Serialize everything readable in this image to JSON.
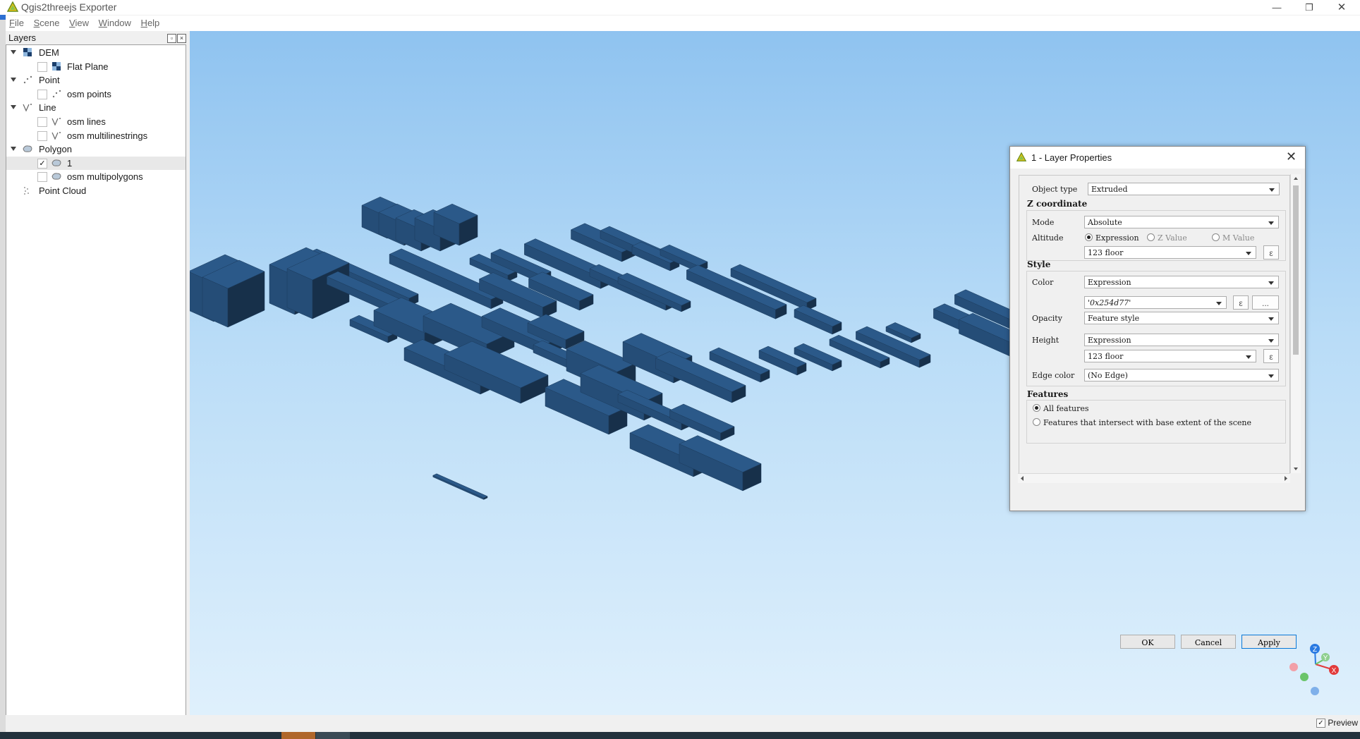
{
  "window": {
    "title": "Qgis2threejs Exporter"
  },
  "menu": [
    "File",
    "Scene",
    "View",
    "Window",
    "Help"
  ],
  "layers_panel": {
    "title": "Layers",
    "tree": [
      {
        "label": "DEM",
        "level": 0,
        "expanded": true,
        "icon": "dem-icon"
      },
      {
        "label": "Flat Plane",
        "level": 1,
        "checked": false,
        "icon": "raster-icon"
      },
      {
        "label": "Point",
        "level": 0,
        "expanded": true,
        "icon": "point-icon"
      },
      {
        "label": "osm points",
        "level": 1,
        "checked": false,
        "icon": "point-icon"
      },
      {
        "label": "Line",
        "level": 0,
        "expanded": true,
        "icon": "line-icon"
      },
      {
        "label": "osm lines",
        "level": 1,
        "checked": false,
        "icon": "line-icon"
      },
      {
        "label": "osm multilinestrings",
        "level": 1,
        "checked": false,
        "icon": "line-icon"
      },
      {
        "label": "Polygon",
        "level": 0,
        "expanded": true,
        "icon": "polygon-icon"
      },
      {
        "label": "1",
        "level": 1,
        "checked": true,
        "selected": true,
        "icon": "polygon-icon"
      },
      {
        "label": "osm multipolygons",
        "level": 1,
        "checked": false,
        "icon": "polygon-icon"
      },
      {
        "label": "Point Cloud",
        "level": 0,
        "expanded": false,
        "icon": "point-cloud-icon"
      }
    ]
  },
  "scene": {
    "building_color": "#254d77",
    "axis_labels": {
      "z": "Z",
      "y": "Y",
      "x": "X"
    }
  },
  "status": {
    "preview_label": "Preview",
    "preview_checked": true
  },
  "dialog": {
    "title": "1 - Layer Properties",
    "object_type_label": "Object type",
    "object_type_value": "Extruded",
    "z_section": "Z coordinate",
    "mode_label": "Mode",
    "mode_value": "Absolute",
    "altitude_label": "Altitude",
    "altitude_options": [
      "Expression",
      "Z Value",
      "M Value"
    ],
    "altitude_expression": "123 floor",
    "style_section": "Style",
    "color_label": "Color",
    "color_mode": "Expression",
    "color_expression": "'0x254d77'",
    "opacity_label": "Opacity",
    "opacity_value": "Feature style",
    "height_label": "Height",
    "height_mode": "Expression",
    "height_expression": "123 floor",
    "edge_color_label": "Edge color",
    "edge_color_value": "(No Edge)",
    "features_section": "Features",
    "features_all": "All features",
    "features_intersect": "Features that intersect with base extent of the scene",
    "epsilon": "ε",
    "ellipsis": "...",
    "ok": "OK",
    "cancel": "Cancel",
    "apply": "Apply"
  }
}
